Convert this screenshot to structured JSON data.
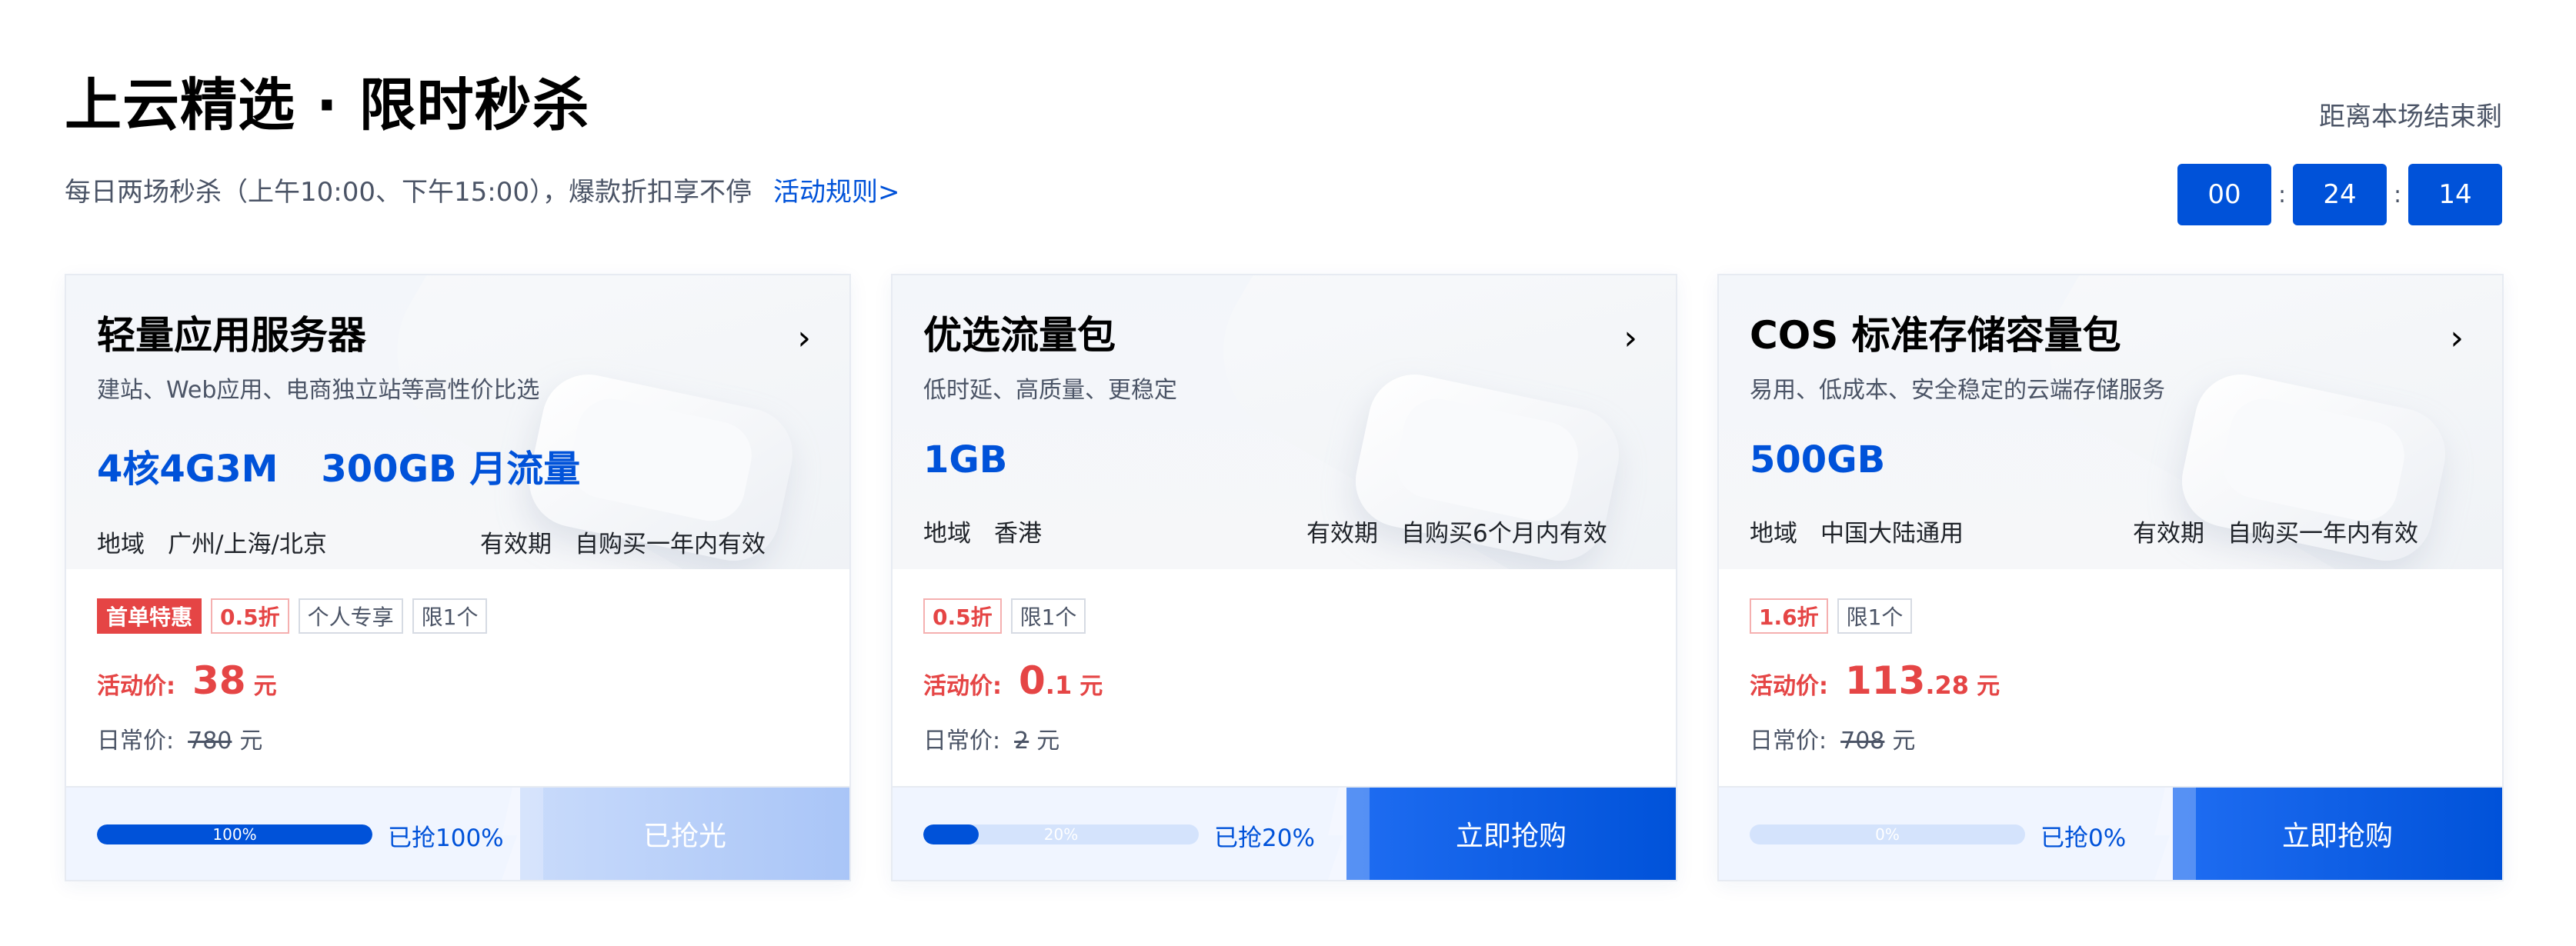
{
  "header": {
    "title": "上云精选 · 限时秒杀",
    "subtitle": "每日两场秒杀（上午10:00、下午15:00），爆款折扣享不停",
    "rules_link": "活动规则>"
  },
  "countdown": {
    "label": "距离本场结束剩",
    "hours": "00",
    "minutes": "24",
    "seconds": "14",
    "separator": ":"
  },
  "labels": {
    "region": "地域",
    "validity": "有效期",
    "activity_price": "活动价:",
    "normal_price": "日常价:",
    "unit": "元"
  },
  "cards": [
    {
      "name": "轻量应用服务器",
      "desc": "建站、Web应用、电商独立站等高性价比选",
      "spec1": "4核4G3M",
      "spec2": "300GB 月流量",
      "region": "广州/上海/北京",
      "validity": "自购买一年内有效",
      "tag_hot": "首单特惠",
      "tag_discount": "0.5折",
      "tag_personal": "个人专享",
      "tag_limit": "限1个",
      "price_int": "38",
      "price_dec": "",
      "normal_price": "780",
      "progress": 100,
      "progress_text": "100%",
      "grabbed": "已抢100%",
      "button": "已抢光",
      "sold_out": true
    },
    {
      "name": "优选流量包",
      "desc": "低时延、高质量、更稳定",
      "spec1": "1GB",
      "spec2": "",
      "region": "香港",
      "validity": "自购买6个月内有效",
      "tag_discount": "0.5折",
      "tag_limit": "限1个",
      "price_int": "0",
      "price_dec": ".1",
      "normal_price": "2",
      "progress": 20,
      "progress_text": "20%",
      "grabbed": "已抢20%",
      "button": "立即抢购",
      "sold_out": false
    },
    {
      "name": "COS 标准存储容量包",
      "desc": "易用、低成本、安全稳定的云端存储服务",
      "spec1": "500GB",
      "spec2": "",
      "region": "中国大陆通用",
      "validity": "自购买一年内有效",
      "tag_discount": "1.6折",
      "tag_limit": "限1个",
      "price_int": "113",
      "price_dec": ".28",
      "normal_price": "708",
      "progress": 0,
      "progress_text": "0%",
      "grabbed": "已抢0%",
      "button": "立即抢购",
      "sold_out": false
    }
  ],
  "colors": {
    "brand_blue": "#0052d9",
    "price_red": "#e54545"
  },
  "icons": {
    "card_arrow": "chevron-right-icon"
  }
}
